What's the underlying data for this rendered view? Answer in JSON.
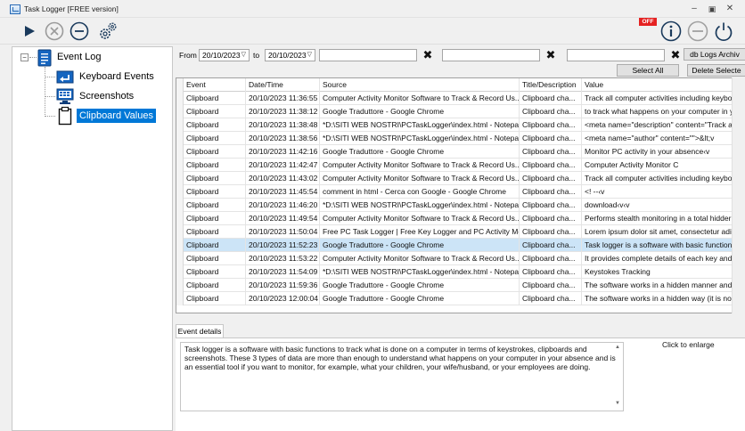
{
  "window": {
    "title": "Task Logger [FREE version]"
  },
  "toolbar": {
    "off_badge": "OFF",
    "buttons": [
      "play-icon",
      "stop-icon",
      "minus-icon",
      "settings-icon"
    ],
    "right_buttons": [
      "info-icon",
      "minus-icon",
      "power-icon"
    ]
  },
  "tree": {
    "root": "Event Log",
    "children": [
      {
        "label": "Keyboard Events",
        "icon": "keyboard-icon"
      },
      {
        "label": "Screenshots",
        "icon": "screenshot-icon"
      },
      {
        "label": "Clipboard Values",
        "icon": "clipboard-icon",
        "selected": true
      }
    ]
  },
  "filters": {
    "from_label": "From",
    "to_label": "to",
    "from_date": "20/10/2023",
    "to_date": "20/10/2023",
    "text1": "",
    "text2": "",
    "text3": "",
    "db_button": "db Logs Archiv",
    "select_all": "Select All",
    "delete_selected": "Delete Selecte"
  },
  "grid": {
    "columns": [
      "Event",
      "Date/Time",
      "Source",
      "Title/Description",
      "Value"
    ],
    "rows": [
      [
        "Clipboard",
        "20/10/2023 11:36:55",
        "Computer Activity Monitor Software to Track & Record Us...",
        "Clipboard cha...",
        "Track all computer activities including keybo"
      ],
      [
        "Clipboard",
        "20/10/2023 11:38:12",
        "Google Traduttore - Google Chrome",
        "Clipboard cha...",
        "to track what happens on your computer in y"
      ],
      [
        "Clipboard",
        "20/10/2023 11:38:48",
        "*D:\\SITI WEB NOSTRI\\PCTaskLogger\\index.html - Notepa...",
        "Clipboard cha...",
        "<meta name=\"description\" content=\"Track a"
      ],
      [
        "Clipboard",
        "20/10/2023 11:38:56",
        "*D:\\SITI WEB NOSTRI\\PCTaskLogger\\index.html - Notepa...",
        "Clipboard cha...",
        "<meta name=\"author\" content=\"\">&lt;v"
      ],
      [
        "Clipboard",
        "20/10/2023 11:42:16",
        "Google Traduttore - Google Chrome",
        "Clipboard cha...",
        "Monitor PC activity in your absence‹v"
      ],
      [
        "Clipboard",
        "20/10/2023 11:42:47",
        "Computer Activity Monitor Software to Track & Record Us...",
        "Clipboard cha...",
        "Computer Activity Monitor C"
      ],
      [
        "Clipboard",
        "20/10/2023 11:43:02",
        "Computer Activity Monitor Software to Track & Record Us...",
        "Clipboard cha...",
        "Track all computer activities including keybo"
      ],
      [
        "Clipboard",
        "20/10/2023 11:45:54",
        "comment in html - Cerca con Google - Google Chrome",
        "Clipboard cha...",
        "<! --‹v"
      ],
      [
        "Clipboard",
        "20/10/2023 11:46:20",
        "*D:\\SITI WEB NOSTRI\\PCTaskLogger\\index.html - Notepa...",
        "Clipboard cha...",
        "download‹v‹v"
      ],
      [
        "Clipboard",
        "20/10/2023 11:49:54",
        "Computer Activity Monitor Software to Track & Record Us...",
        "Clipboard cha...",
        "Performs stealth monitoring in a total hidder"
      ],
      [
        "Clipboard",
        "20/10/2023 11:50:04",
        "Free PC Task Logger | Free Key Logger and PC Activity Mo...",
        "Clipboard cha...",
        "Lorem ipsum dolor sit amet, consectetur adi"
      ],
      [
        "Clipboard",
        "20/10/2023 11:52:23",
        "Google Traduttore - Google Chrome",
        "Clipboard cha...",
        "Task logger is a software with basic functions"
      ],
      [
        "Clipboard",
        "20/10/2023 11:53:22",
        "Computer Activity Monitor Software to Track & Record Us...",
        "Clipboard cha...",
        "It provides complete details of each key and"
      ],
      [
        "Clipboard",
        "20/10/2023 11:54:09",
        "*D:\\SITI WEB NOSTRI\\PCTaskLogger\\index.html - Notepa...",
        "Clipboard cha...",
        "Keystokes Tracking"
      ],
      [
        "Clipboard",
        "20/10/2023 11:59:36",
        "Google Traduttore - Google Chrome",
        "Clipboard cha...",
        "The software works in a hidden manner and"
      ],
      [
        "Clipboard",
        "20/10/2023 12:00:04",
        "Google Traduttore - Google Chrome",
        "Clipboard cha...",
        "The software works in a hidden way (it is not"
      ]
    ],
    "selected_row": 11
  },
  "details": {
    "tab_label": "Event details",
    "text": "Task logger is a software with basic functions to track what is done on a computer in terms of keystrokes, clipboards and screenshots. These 3 types of data are more than enough to understand what happens on your computer in your absence and is an essential tool if you want to monitor, for example, what your children, your wife/husband, or your employees are doing.",
    "click_to_enlarge": "Click to enlarge"
  }
}
